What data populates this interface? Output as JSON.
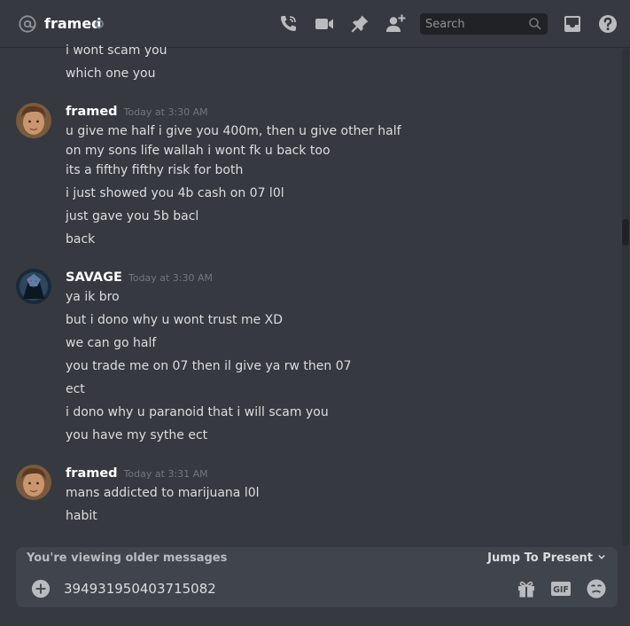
{
  "header": {
    "channel_name": "framed",
    "search_placeholder": "Search",
    "icons": [
      "at-icon",
      "status-icon",
      "call-icon",
      "video-icon",
      "pin-icon",
      "add-friend-icon",
      "search-icon",
      "inbox-icon",
      "help-icon"
    ]
  },
  "messages": {
    "prior_lines": [
      "i wont scam you",
      "which one you"
    ],
    "groups": [
      {
        "author": "framed",
        "timestamp": "Today at 3:30 AM",
        "lines": [
          "u give me half i give you 400m, then u give other half",
          "on my sons life wallah i wont fk u back too",
          "its a fifthy fifthy risk for both",
          "i just showed you 4b cash on 07 l0l",
          "just gave you 5b bacl",
          "back"
        ]
      },
      {
        "author": "SAVAGE",
        "timestamp": "Today at 3:30 AM",
        "lines": [
          "ya ik bro",
          "but i dono why u wont trust me XD",
          "we can go half",
          "you trade me on 07 then il give ya rw then 07",
          "ect",
          "i dono why u paranoid that i will scam you",
          "you have my sythe ect"
        ]
      },
      {
        "author": "framed",
        "timestamp": "Today at 3:31 AM",
        "lines": [
          "mans addicted to marijuana l0l",
          "habit"
        ]
      }
    ]
  },
  "banner": {
    "text": "You're viewing older messages",
    "jump_label": "Jump To Present"
  },
  "composer": {
    "value": "394931950403715082",
    "icons": [
      "add-attachment-icon",
      "gift-icon",
      "gif-icon",
      "emoji-icon"
    ]
  },
  "colors": {
    "background": "#36393f",
    "text": "#dcddde",
    "muted": "#72767d",
    "input_bg": "#40444b",
    "search_bg": "#202225"
  }
}
